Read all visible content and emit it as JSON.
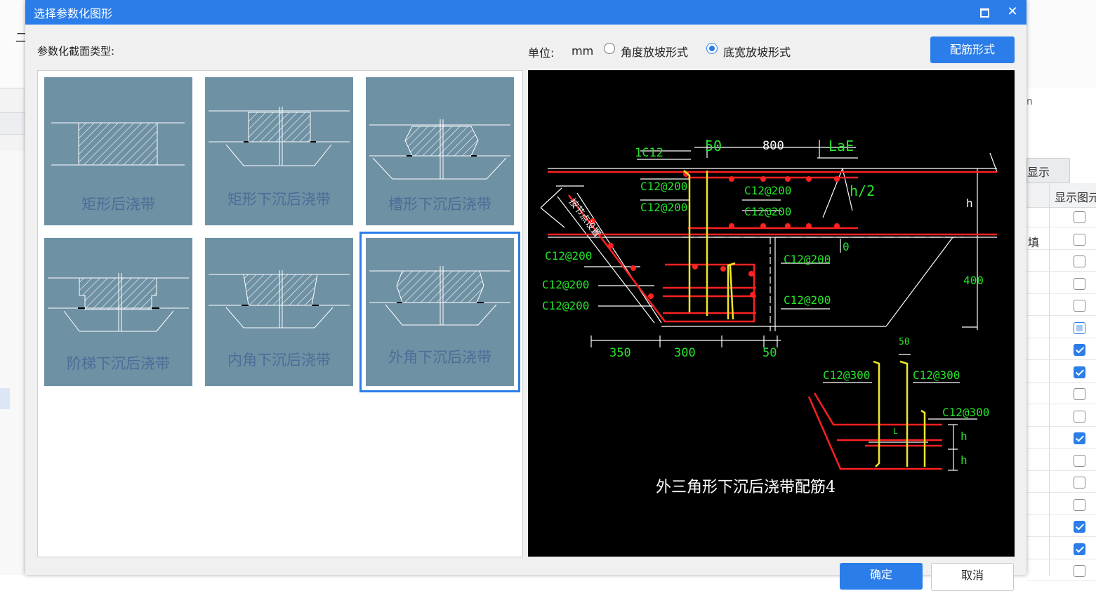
{
  "dialog": {
    "title": "选择参数化图形",
    "section_label": "参数化截面类型:",
    "unit_label": "单位:",
    "unit_value": "mm",
    "radio_angle": "角度放坡形式",
    "radio_width": "底宽放坡形式",
    "rebar_button": "配筋形式",
    "ok_button": "确定",
    "cancel_button": "取消",
    "selected_option": "底宽放坡形式"
  },
  "shapes": [
    {
      "label": "矩形后浇带",
      "selected": false
    },
    {
      "label": "矩形下沉后浇带",
      "selected": false
    },
    {
      "label": "槽形下沉后浇带",
      "selected": false
    },
    {
      "label": "阶梯下沉后浇带",
      "selected": false
    },
    {
      "label": "内角下沉后浇带",
      "selected": false
    },
    {
      "label": "外角下沉后浇带",
      "selected": true
    }
  ],
  "preview": {
    "caption": "外三角形下沉后浇带配筋4",
    "dims": {
      "d50": "50",
      "d800": "800",
      "lae": "LaE",
      "h2": "h/2",
      "h": "h",
      "d0": "0",
      "d400": "400",
      "d350": "350",
      "d300": "300",
      "d50b": "50",
      "d50c": "50",
      "hA": "h",
      "hB": "h",
      "L": "L"
    },
    "rebars": {
      "r1c12": "1C12",
      "a": "C12@200",
      "b": "C12@200",
      "c": "C12@200",
      "d": "C12@200",
      "e": "C12@200",
      "f": "C12@200",
      "g": "C12@200",
      "i": "C12@200",
      "j": "C12@200",
      "k": "C12@300",
      "l": "C12@300",
      "m": "C12@300"
    },
    "note": "按节点设置"
  },
  "background": {
    "right_panel_tab": "显示",
    "right_panel_header": "显示图元",
    "right_fill": "填",
    "right_n": "n",
    "checkboxes": [
      "off",
      "off",
      "off",
      "off",
      "off",
      "partial",
      "on",
      "on",
      "off",
      "off",
      "on",
      "off",
      "off",
      "off",
      "on",
      "on",
      "off"
    ]
  }
}
